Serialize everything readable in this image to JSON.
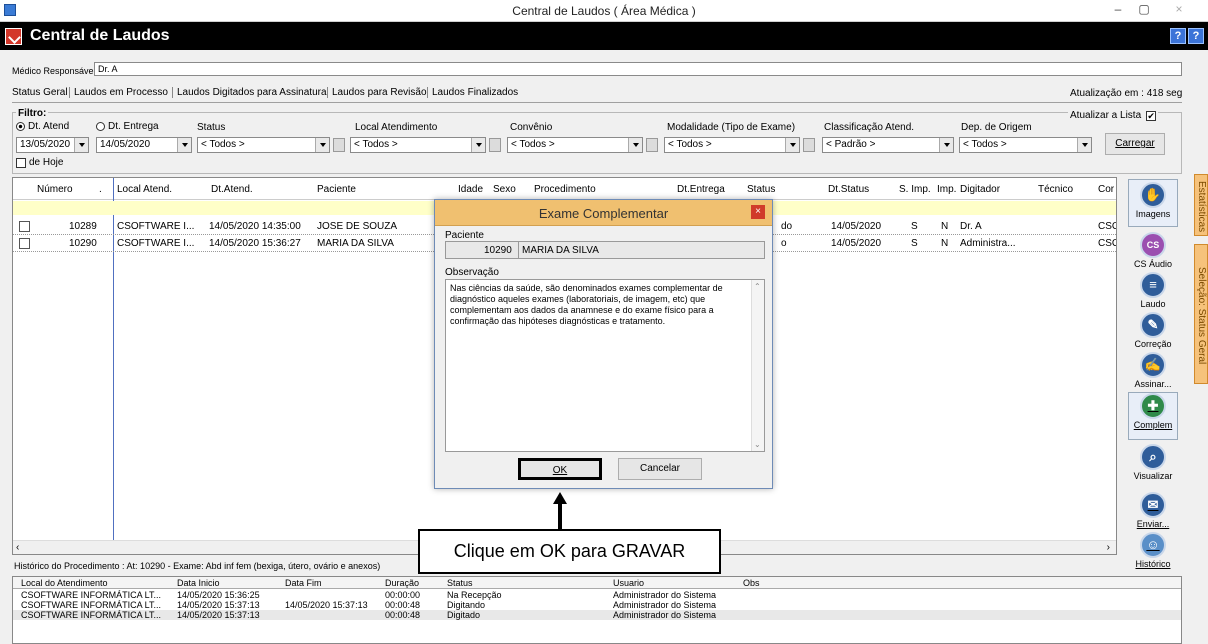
{
  "window": {
    "title": "Central de Laudos ( Área Médica )",
    "min": "–",
    "max": "▢",
    "close": "×"
  },
  "app": {
    "name": "Central de Laudos",
    "help1": "?",
    "help2": "?"
  },
  "medico": {
    "label": "Médico Responsável:",
    "value": "Dr. A"
  },
  "tabs": [
    "Status Geral",
    "Laudos em Processo",
    "Laudos Digitados para Assinatura",
    "Laudos para Revisão",
    "Laudos Finalizados"
  ],
  "atualizacao": "Atualização em : 418 seg",
  "filtro": {
    "label": "Filtro:",
    "radio1": "Dt. Atend",
    "radio2": "Dt. Entrega",
    "date1": "13/05/2020",
    "date2": "14/05/2020",
    "de_hoje": "de Hoje",
    "status_label": "Status",
    "status_value": "< Todos >",
    "local_label": "Local Atendimento",
    "local_value": "< Todos >",
    "convenio_label": "Convênio",
    "convenio_value": "< Todos >",
    "modalidade_label": "Modalidade (Tipo de Exame)",
    "modalidade_value": "< Todos >",
    "classificacao_label": "Classificação Atend.",
    "classificacao_value": "< Padrão >",
    "dep_label": "Dep. de Origem",
    "dep_value": "< Todos >",
    "atualizar_label": "Atualizar a Lista",
    "carregar": "Carregar"
  },
  "grid": {
    "headers": [
      "Número",
      ".",
      "Local Atend.",
      "Dt.Atend.",
      "Paciente",
      "Idade",
      "Sexo",
      "Procedimento",
      "Dt.Entrega",
      "Status",
      "Dt.Status",
      "S. Imp.",
      "Imp.",
      "Digitador",
      "Técnico",
      "Cor"
    ],
    "rows": [
      {
        "numero": "10289",
        "local": "CSOFTWARE I...",
        "dt": "14/05/2020 14:35:00",
        "paciente": "JOSE DE SOUZA",
        "status": "do",
        "dtstatus": "14/05/2020",
        "simp": "S",
        "imp": "N",
        "digitador": "Dr. A",
        "cor": "CSC"
      },
      {
        "numero": "10290",
        "local": "CSOFTWARE I...",
        "dt": "14/05/2020 15:36:27",
        "paciente": "MARIA DA SILVA",
        "status": "o",
        "dtstatus": "14/05/2020",
        "simp": "S",
        "imp": "N",
        "digitador": "Administra...",
        "cor": "CSC"
      }
    ]
  },
  "side": [
    "Imagens",
    "CS Áudio",
    "Laudo",
    "Correção",
    "Assinar...",
    "Complem",
    "Visualizar",
    "Enviar...",
    "Histórico"
  ],
  "vertical_tabs": [
    "Estatísticas",
    "Seleção: Status Geral"
  ],
  "historico": {
    "title": "Histórico do Procedimento : At: 10290 - Exame: Abd inf fem (bexiga, útero, ovário e anexos)",
    "headers": [
      "Local do Atendimento",
      "Data Inicio",
      "Data Fim",
      "Duração",
      "Status",
      "Usuario",
      "Obs"
    ],
    "rows": [
      [
        "CSOFTWARE INFORMÁTICA LT...",
        "14/05/2020 15:36:25",
        "",
        "00:00:00",
        "Na Recepção",
        "Administrador do Sistema",
        ""
      ],
      [
        "CSOFTWARE INFORMÁTICA LT...",
        "14/05/2020 15:37:13",
        "14/05/2020 15:37:13",
        "00:00:48",
        "Digitando",
        "Administrador do Sistema",
        ""
      ],
      [
        "CSOFTWARE INFORMÁTICA LT...",
        "14/05/2020 15:37:13",
        "",
        "00:00:48",
        "Digitado",
        "Administrador do Sistema",
        ""
      ]
    ]
  },
  "dialog": {
    "title": "Exame Complementar",
    "paciente_label": "Paciente",
    "numero": "10290",
    "nome": "MARIA DA SILVA",
    "obs_label": "Observação",
    "obs_text": "Nas ciências da saúde, são denominados exames complementar de diagnóstico aqueles exames (laboratoriais, de imagem, etc) que complementam aos dados da anamnese e do exame físico para a confirmação das hipóteses diagnósticas e tratamento.",
    "ok": "OK",
    "cancel": "Cancelar"
  },
  "callout": "Clique em OK para GRAVAR"
}
